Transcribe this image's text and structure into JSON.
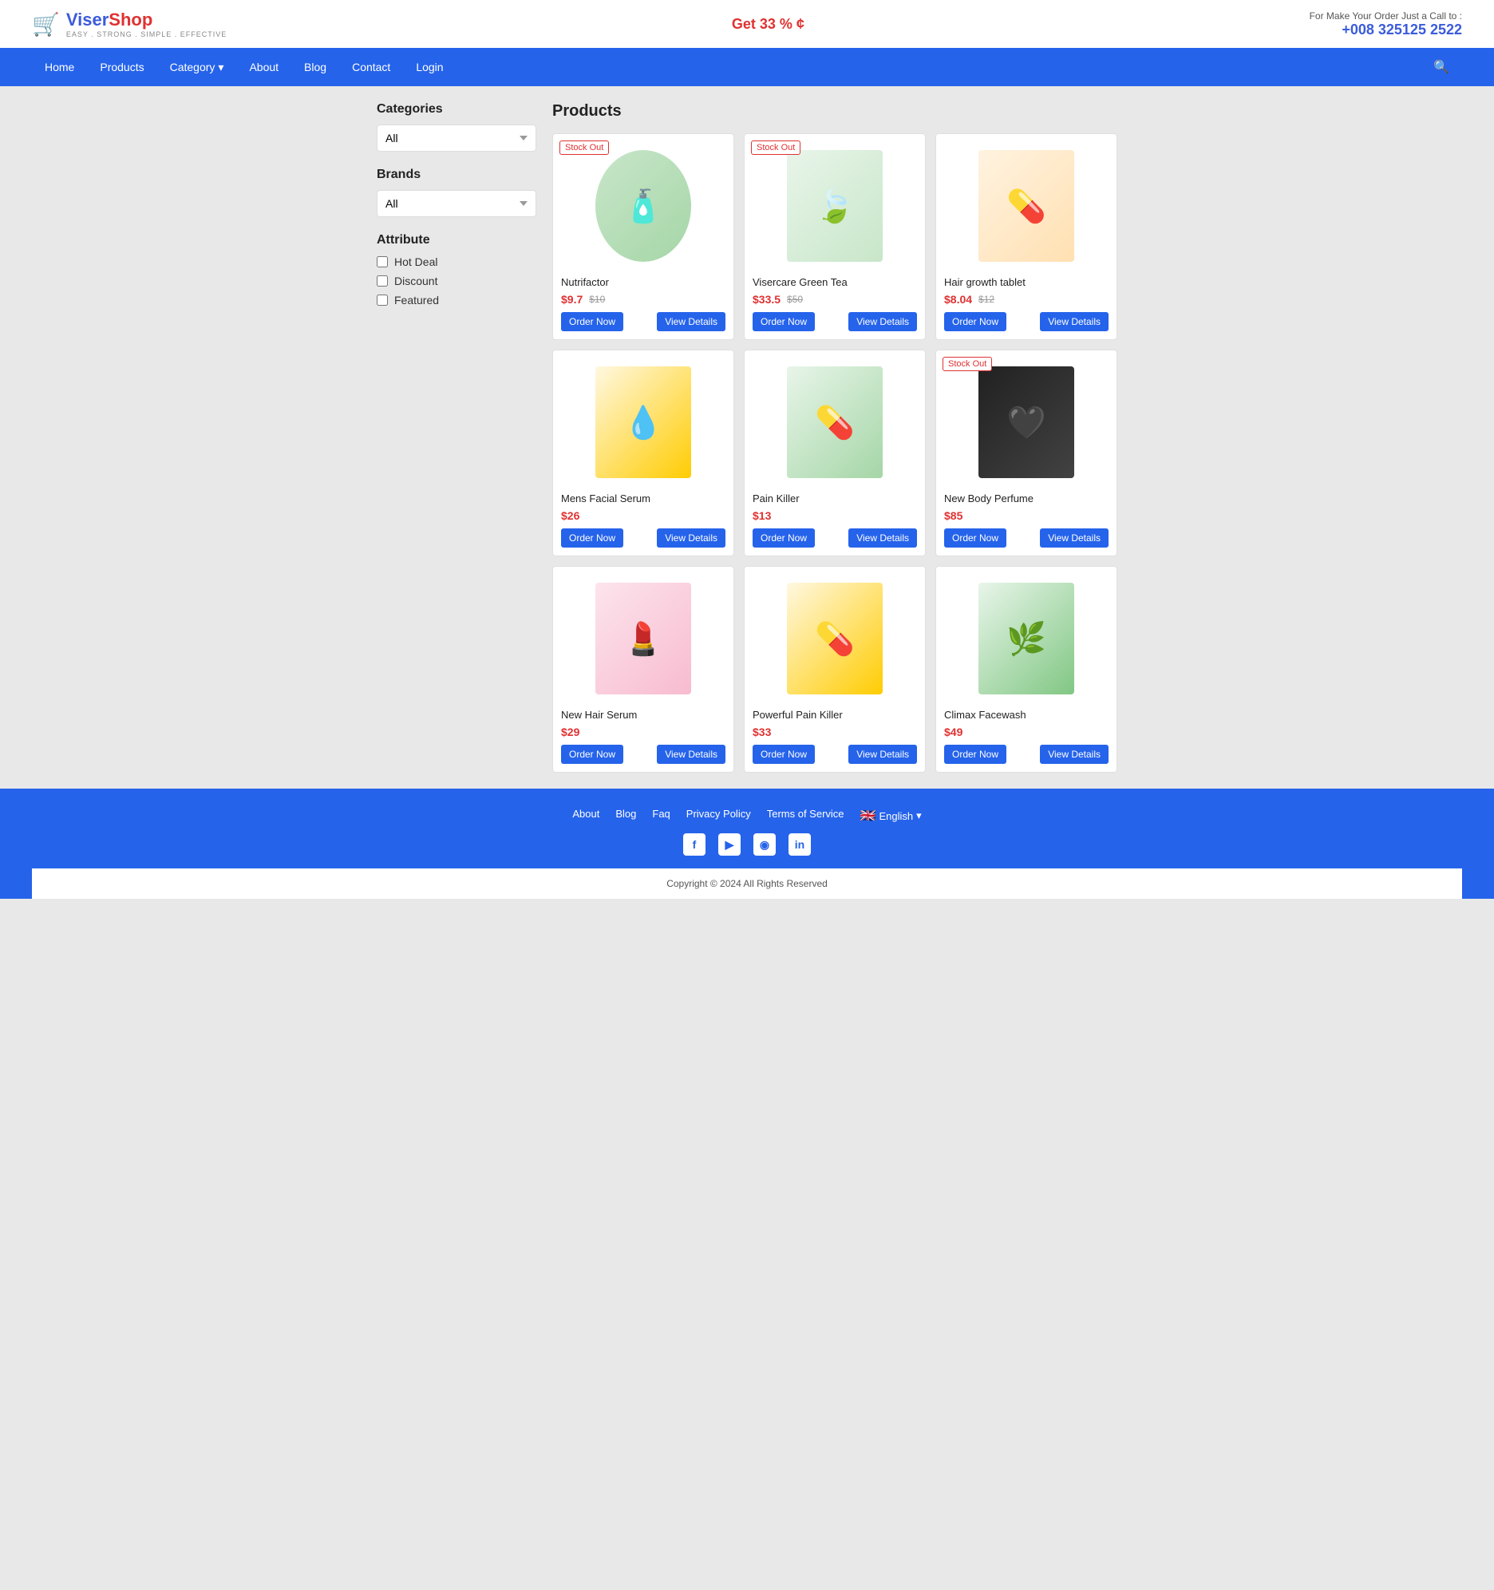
{
  "header": {
    "logo_text": "ViserShop",
    "logo_subtitle": "EASY . STRONG . SIMPLE . EFFECTIVE",
    "promo_text": "Get 33 % ¢",
    "contact_label": "For Make Your Order Just a Call to :",
    "contact_phone": "+008 325125 2522"
  },
  "nav": {
    "items": [
      {
        "label": "Home",
        "href": "#"
      },
      {
        "label": "Products",
        "href": "#"
      },
      {
        "label": "Category",
        "href": "#",
        "has_dropdown": true
      },
      {
        "label": "About",
        "href": "#"
      },
      {
        "label": "Blog",
        "href": "#"
      },
      {
        "label": "Contact",
        "href": "#"
      },
      {
        "label": "Login",
        "href": "#"
      }
    ]
  },
  "sidebar": {
    "categories_title": "Categories",
    "categories_options": [
      "All"
    ],
    "categories_selected": "All",
    "brands_title": "Brands",
    "brands_options": [
      "All"
    ],
    "brands_selected": "All",
    "attribute_title": "Attribute",
    "attributes": [
      {
        "label": "Hot Deal",
        "checked": false
      },
      {
        "label": "Discount",
        "checked": false
      },
      {
        "label": "Featured",
        "checked": false
      }
    ]
  },
  "products": {
    "title": "Products",
    "items": [
      {
        "id": 1,
        "name": "Nutrifactor",
        "price": "$9.7",
        "original_price": "$10",
        "stock_out": true,
        "icon": "🧴",
        "color_class": "img-nutrifactor"
      },
      {
        "id": 2,
        "name": "Visercare Green Tea",
        "price": "$33.5",
        "original_price": "$50",
        "stock_out": true,
        "icon": "🍃",
        "color_class": "img-greentea"
      },
      {
        "id": 3,
        "name": "Hair growth tablet",
        "price": "$8.04",
        "original_price": "$12",
        "stock_out": false,
        "icon": "💊",
        "color_class": "img-hairtablet"
      },
      {
        "id": 4,
        "name": "Mens Facial Serum",
        "price": "$26",
        "original_price": "",
        "stock_out": false,
        "icon": "💧",
        "color_class": "img-serum"
      },
      {
        "id": 5,
        "name": "Pain Killer",
        "price": "$13",
        "original_price": "",
        "stock_out": false,
        "icon": "💊",
        "color_class": "img-painkiller"
      },
      {
        "id": 6,
        "name": "New Body Perfume",
        "price": "$85",
        "original_price": "",
        "stock_out": true,
        "icon": "🖤",
        "color_class": "img-perfume"
      },
      {
        "id": 7,
        "name": "New Hair Serum",
        "price": "$29",
        "original_price": "",
        "stock_out": false,
        "icon": "💄",
        "color_class": "img-hairserum"
      },
      {
        "id": 8,
        "name": "Powerful Pain Killer",
        "price": "$33",
        "original_price": "",
        "stock_out": false,
        "icon": "💊",
        "color_class": "img-powerpainkiller"
      },
      {
        "id": 9,
        "name": "Climax Facewash",
        "price": "$49",
        "original_price": "",
        "stock_out": false,
        "icon": "🌿",
        "color_class": "img-facewash"
      }
    ],
    "order_now_label": "Order Now",
    "view_details_label": "View Details",
    "stock_out_label": "Stock Out"
  },
  "footer": {
    "links": [
      {
        "label": "About",
        "href": "#"
      },
      {
        "label": "Blog",
        "href": "#"
      },
      {
        "label": "Faq",
        "href": "#"
      },
      {
        "label": "Privacy Policy",
        "href": "#"
      },
      {
        "label": "Terms of Service",
        "href": "#"
      }
    ],
    "language_label": "English",
    "social": [
      {
        "name": "Facebook",
        "icon": "f"
      },
      {
        "name": "YouTube",
        "icon": "▶"
      },
      {
        "name": "Instagram",
        "icon": "◉"
      },
      {
        "name": "LinkedIn",
        "icon": "in"
      }
    ],
    "copyright": "Copyright © 2024 All Rights Reserved"
  }
}
